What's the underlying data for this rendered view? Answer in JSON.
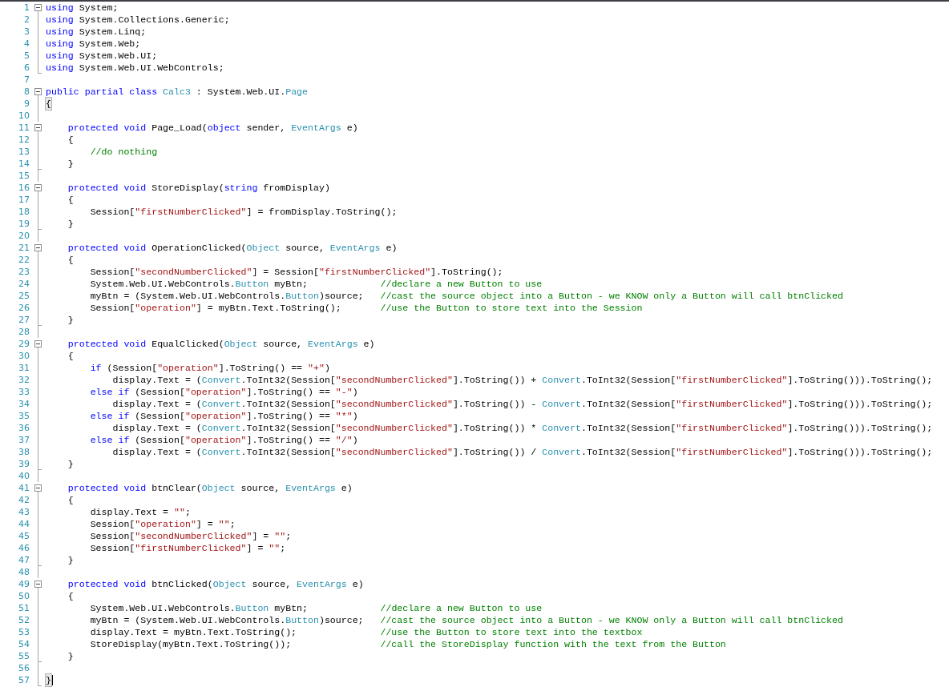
{
  "editor": {
    "lines": [
      {
        "number": "1",
        "kind": "fold_start",
        "tokens": [
          {
            "kind": "keyword",
            "text": "using"
          },
          {
            "kind": "plain",
            "text": " System;"
          }
        ]
      },
      {
        "number": "2",
        "kind": "fold_body",
        "tokens": [
          {
            "kind": "keyword",
            "text": "using"
          },
          {
            "kind": "plain",
            "text": " System.Collections.Generic;"
          }
        ]
      },
      {
        "number": "3",
        "kind": "fold_body",
        "tokens": [
          {
            "kind": "keyword",
            "text": "using"
          },
          {
            "kind": "plain",
            "text": " System.Linq;"
          }
        ]
      },
      {
        "number": "4",
        "kind": "fold_body",
        "tokens": [
          {
            "kind": "keyword",
            "text": "using"
          },
          {
            "kind": "plain",
            "text": " System.Web;"
          }
        ]
      },
      {
        "number": "5",
        "kind": "fold_body",
        "tokens": [
          {
            "kind": "keyword",
            "text": "using"
          },
          {
            "kind": "plain",
            "text": " System.Web.UI;"
          }
        ]
      },
      {
        "number": "6",
        "kind": "fold_end",
        "tokens": [
          {
            "kind": "keyword",
            "text": "using"
          },
          {
            "kind": "plain",
            "text": " System.Web.UI.WebControls;"
          }
        ]
      },
      {
        "number": "7",
        "kind": "plain"
      },
      {
        "number": "8",
        "kind": "fold_start",
        "tokens": [
          {
            "kind": "keyword",
            "text": "public partial class "
          },
          {
            "kind": "type",
            "text": "Calc3"
          },
          {
            "kind": "plain",
            "text": " : System.Web.UI."
          },
          {
            "kind": "type",
            "text": "Page"
          }
        ]
      },
      {
        "number": "9",
        "kind": "fold_body",
        "tokens": [
          {
            "kind": "brace",
            "text": "{"
          }
        ]
      },
      {
        "number": "10",
        "kind": "fold_body"
      },
      {
        "number": "11",
        "kind": "fold_start",
        "tokens": [
          {
            "kind": "keyword",
            "text": "    protected void"
          },
          {
            "kind": "plain",
            "text": " Page_Load("
          },
          {
            "kind": "keyword",
            "text": "object"
          },
          {
            "kind": "plain",
            "text": " sender, "
          },
          {
            "kind": "type",
            "text": "EventArgs"
          },
          {
            "kind": "plain",
            "text": " e)"
          }
        ]
      },
      {
        "number": "12",
        "kind": "fold_body",
        "tokens": [
          {
            "kind": "plain",
            "text": "    {"
          }
        ]
      },
      {
        "number": "13",
        "kind": "fold_body",
        "tokens": [
          {
            "kind": "comment",
            "text": "        //do nothing"
          }
        ]
      },
      {
        "number": "14",
        "kind": "fold_end",
        "tokens": [
          {
            "kind": "plain",
            "text": "    }"
          }
        ]
      },
      {
        "number": "15",
        "kind": "fold_body"
      },
      {
        "number": "16",
        "kind": "fold_start",
        "tokens": [
          {
            "kind": "keyword",
            "text": "    protected void"
          },
          {
            "kind": "plain",
            "text": " StoreDisplay("
          },
          {
            "kind": "keyword",
            "text": "string"
          },
          {
            "kind": "plain",
            "text": " fromDisplay)"
          }
        ]
      },
      {
        "number": "17",
        "kind": "fold_body",
        "tokens": [
          {
            "kind": "plain",
            "text": "    {"
          }
        ]
      },
      {
        "number": "18",
        "kind": "fold_body",
        "tokens": [
          {
            "kind": "plain",
            "text": "        Session["
          },
          {
            "kind": "string",
            "text": "\"firstNumberClicked\""
          },
          {
            "kind": "plain",
            "text": "] = fromDisplay.ToString();"
          }
        ]
      },
      {
        "number": "19",
        "kind": "fold_end",
        "tokens": [
          {
            "kind": "plain",
            "text": "    }"
          }
        ]
      },
      {
        "number": "20",
        "kind": "fold_body"
      },
      {
        "number": "21",
        "kind": "fold_start",
        "tokens": [
          {
            "kind": "keyword",
            "text": "    protected void"
          },
          {
            "kind": "plain",
            "text": " OperationClicked("
          },
          {
            "kind": "type",
            "text": "Object"
          },
          {
            "kind": "plain",
            "text": " source, "
          },
          {
            "kind": "type",
            "text": "EventArgs"
          },
          {
            "kind": "plain",
            "text": " e)"
          }
        ]
      },
      {
        "number": "22",
        "kind": "fold_body",
        "tokens": [
          {
            "kind": "plain",
            "text": "    {"
          }
        ]
      },
      {
        "number": "23",
        "kind": "fold_body",
        "tokens": [
          {
            "kind": "plain",
            "text": "        Session["
          },
          {
            "kind": "string",
            "text": "\"secondNumberClicked\""
          },
          {
            "kind": "plain",
            "text": "] = Session["
          },
          {
            "kind": "string",
            "text": "\"firstNumberClicked\""
          },
          {
            "kind": "plain",
            "text": "].ToString();"
          }
        ]
      },
      {
        "number": "24",
        "kind": "fold_body",
        "tokens": [
          {
            "kind": "plain",
            "text": "        System.Web.UI.WebControls."
          },
          {
            "kind": "type",
            "text": "Button"
          },
          {
            "kind": "plain",
            "text": " myBtn;             "
          },
          {
            "kind": "comment",
            "text": "//declare a new Button to use"
          }
        ]
      },
      {
        "number": "25",
        "kind": "fold_body",
        "tokens": [
          {
            "kind": "plain",
            "text": "        myBtn = (System.Web.UI.WebControls."
          },
          {
            "kind": "type",
            "text": "Button"
          },
          {
            "kind": "plain",
            "text": ")source;   "
          },
          {
            "kind": "comment",
            "text": "//cast the source object into a Button - we KNOW only a Button will call btnClicked"
          }
        ]
      },
      {
        "number": "26",
        "kind": "fold_body",
        "tokens": [
          {
            "kind": "plain",
            "text": "        Session["
          },
          {
            "kind": "string",
            "text": "\"operation\""
          },
          {
            "kind": "plain",
            "text": "] = myBtn.Text.ToString();       "
          },
          {
            "kind": "comment",
            "text": "//use the Button to store text into the Session"
          }
        ]
      },
      {
        "number": "27",
        "kind": "fold_end",
        "tokens": [
          {
            "kind": "plain",
            "text": "    }"
          }
        ]
      },
      {
        "number": "28",
        "kind": "fold_body"
      },
      {
        "number": "29",
        "kind": "fold_start",
        "tokens": [
          {
            "kind": "keyword",
            "text": "    protected void"
          },
          {
            "kind": "plain",
            "text": " EqualClicked("
          },
          {
            "kind": "type",
            "text": "Object"
          },
          {
            "kind": "plain",
            "text": " source, "
          },
          {
            "kind": "type",
            "text": "EventArgs"
          },
          {
            "kind": "plain",
            "text": " e)"
          }
        ]
      },
      {
        "number": "30",
        "kind": "fold_body",
        "tokens": [
          {
            "kind": "plain",
            "text": "    {"
          }
        ]
      },
      {
        "number": "31",
        "kind": "fold_body",
        "tokens": [
          {
            "kind": "keyword",
            "text": "        if"
          },
          {
            "kind": "plain",
            "text": " (Session["
          },
          {
            "kind": "string",
            "text": "\"operation\""
          },
          {
            "kind": "plain",
            "text": "].ToString() == "
          },
          {
            "kind": "string",
            "text": "\"+\""
          },
          {
            "kind": "plain",
            "text": ")"
          }
        ]
      },
      {
        "number": "32",
        "kind": "fold_body",
        "tokens": [
          {
            "kind": "plain",
            "text": "            display.Text = ("
          },
          {
            "kind": "type",
            "text": "Convert"
          },
          {
            "kind": "plain",
            "text": ".ToInt32(Session["
          },
          {
            "kind": "string",
            "text": "\"secondNumberClicked\""
          },
          {
            "kind": "plain",
            "text": "].ToString()) + "
          },
          {
            "kind": "type",
            "text": "Convert"
          },
          {
            "kind": "plain",
            "text": ".ToInt32(Session["
          },
          {
            "kind": "string",
            "text": "\"firstNumberClicked\""
          },
          {
            "kind": "plain",
            "text": "].ToString())).ToString();"
          }
        ]
      },
      {
        "number": "33",
        "kind": "fold_body",
        "tokens": [
          {
            "kind": "keyword",
            "text": "        else if"
          },
          {
            "kind": "plain",
            "text": " (Session["
          },
          {
            "kind": "string",
            "text": "\"operation\""
          },
          {
            "kind": "plain",
            "text": "].ToString() == "
          },
          {
            "kind": "string",
            "text": "\"-\""
          },
          {
            "kind": "plain",
            "text": ")"
          }
        ]
      },
      {
        "number": "34",
        "kind": "fold_body",
        "tokens": [
          {
            "kind": "plain",
            "text": "            display.Text = ("
          },
          {
            "kind": "type",
            "text": "Convert"
          },
          {
            "kind": "plain",
            "text": ".ToInt32(Session["
          },
          {
            "kind": "string",
            "text": "\"secondNumberClicked\""
          },
          {
            "kind": "plain",
            "text": "].ToString()) - "
          },
          {
            "kind": "type",
            "text": "Convert"
          },
          {
            "kind": "plain",
            "text": ".ToInt32(Session["
          },
          {
            "kind": "string",
            "text": "\"firstNumberClicked\""
          },
          {
            "kind": "plain",
            "text": "].ToString())).ToString();"
          }
        ]
      },
      {
        "number": "35",
        "kind": "fold_body",
        "tokens": [
          {
            "kind": "keyword",
            "text": "        else if"
          },
          {
            "kind": "plain",
            "text": " (Session["
          },
          {
            "kind": "string",
            "text": "\"operation\""
          },
          {
            "kind": "plain",
            "text": "].ToString() == "
          },
          {
            "kind": "string",
            "text": "\"*\""
          },
          {
            "kind": "plain",
            "text": ")"
          }
        ]
      },
      {
        "number": "36",
        "kind": "fold_body",
        "tokens": [
          {
            "kind": "plain",
            "text": "            display.Text = ("
          },
          {
            "kind": "type",
            "text": "Convert"
          },
          {
            "kind": "plain",
            "text": ".ToInt32(Session["
          },
          {
            "kind": "string",
            "text": "\"secondNumberClicked\""
          },
          {
            "kind": "plain",
            "text": "].ToString()) * "
          },
          {
            "kind": "type",
            "text": "Convert"
          },
          {
            "kind": "plain",
            "text": ".ToInt32(Session["
          },
          {
            "kind": "string",
            "text": "\"firstNumberClicked\""
          },
          {
            "kind": "plain",
            "text": "].ToString())).ToString();"
          }
        ]
      },
      {
        "number": "37",
        "kind": "fold_body",
        "tokens": [
          {
            "kind": "keyword",
            "text": "        else if"
          },
          {
            "kind": "plain",
            "text": " (Session["
          },
          {
            "kind": "string",
            "text": "\"operation\""
          },
          {
            "kind": "plain",
            "text": "].ToString() == "
          },
          {
            "kind": "string",
            "text": "\"/\""
          },
          {
            "kind": "plain",
            "text": ")"
          }
        ]
      },
      {
        "number": "38",
        "kind": "fold_body",
        "tokens": [
          {
            "kind": "plain",
            "text": "            display.Text = ("
          },
          {
            "kind": "type",
            "text": "Convert"
          },
          {
            "kind": "plain",
            "text": ".ToInt32(Session["
          },
          {
            "kind": "string",
            "text": "\"secondNumberClicked\""
          },
          {
            "kind": "plain",
            "text": "].ToString()) / "
          },
          {
            "kind": "type",
            "text": "Convert"
          },
          {
            "kind": "plain",
            "text": ".ToInt32(Session["
          },
          {
            "kind": "string",
            "text": "\"firstNumberClicked\""
          },
          {
            "kind": "plain",
            "text": "].ToString())).ToString();"
          }
        ]
      },
      {
        "number": "39",
        "kind": "fold_end",
        "tokens": [
          {
            "kind": "plain",
            "text": "    }"
          }
        ]
      },
      {
        "number": "40",
        "kind": "fold_body"
      },
      {
        "number": "41",
        "kind": "fold_start",
        "tokens": [
          {
            "kind": "keyword",
            "text": "    protected void"
          },
          {
            "kind": "plain",
            "text": " btnClear("
          },
          {
            "kind": "type",
            "text": "Object"
          },
          {
            "kind": "plain",
            "text": " source, "
          },
          {
            "kind": "type",
            "text": "EventArgs"
          },
          {
            "kind": "plain",
            "text": " e)"
          }
        ]
      },
      {
        "number": "42",
        "kind": "fold_body",
        "tokens": [
          {
            "kind": "plain",
            "text": "    {"
          }
        ]
      },
      {
        "number": "43",
        "kind": "fold_body",
        "tokens": [
          {
            "kind": "plain",
            "text": "        display.Text = "
          },
          {
            "kind": "string",
            "text": "\"\""
          },
          {
            "kind": "plain",
            "text": ";"
          }
        ]
      },
      {
        "number": "44",
        "kind": "fold_body",
        "tokens": [
          {
            "kind": "plain",
            "text": "        Session["
          },
          {
            "kind": "string",
            "text": "\"operation\""
          },
          {
            "kind": "plain",
            "text": "] = "
          },
          {
            "kind": "string",
            "text": "\"\""
          },
          {
            "kind": "plain",
            "text": ";"
          }
        ]
      },
      {
        "number": "45",
        "kind": "fold_body",
        "tokens": [
          {
            "kind": "plain",
            "text": "        Session["
          },
          {
            "kind": "string",
            "text": "\"secondNumberClicked\""
          },
          {
            "kind": "plain",
            "text": "] = "
          },
          {
            "kind": "string",
            "text": "\"\""
          },
          {
            "kind": "plain",
            "text": ";"
          }
        ]
      },
      {
        "number": "46",
        "kind": "fold_body",
        "tokens": [
          {
            "kind": "plain",
            "text": "        Session["
          },
          {
            "kind": "string",
            "text": "\"firstNumberClicked\""
          },
          {
            "kind": "plain",
            "text": "] = "
          },
          {
            "kind": "string",
            "text": "\"\""
          },
          {
            "kind": "plain",
            "text": ";"
          }
        ]
      },
      {
        "number": "47",
        "kind": "fold_end",
        "tokens": [
          {
            "kind": "plain",
            "text": "    }"
          }
        ]
      },
      {
        "number": "48",
        "kind": "fold_body"
      },
      {
        "number": "49",
        "kind": "fold_start",
        "tokens": [
          {
            "kind": "keyword",
            "text": "    protected void"
          },
          {
            "kind": "plain",
            "text": " btnClicked("
          },
          {
            "kind": "type",
            "text": "Object"
          },
          {
            "kind": "plain",
            "text": " source, "
          },
          {
            "kind": "type",
            "text": "EventArgs"
          },
          {
            "kind": "plain",
            "text": " e)"
          }
        ]
      },
      {
        "number": "50",
        "kind": "fold_body",
        "tokens": [
          {
            "kind": "plain",
            "text": "    {"
          }
        ]
      },
      {
        "number": "51",
        "kind": "fold_body",
        "tokens": [
          {
            "kind": "plain",
            "text": "        System.Web.UI.WebControls."
          },
          {
            "kind": "type",
            "text": "Button"
          },
          {
            "kind": "plain",
            "text": " myBtn;             "
          },
          {
            "kind": "comment",
            "text": "//declare a new Button to use"
          }
        ]
      },
      {
        "number": "52",
        "kind": "fold_body",
        "tokens": [
          {
            "kind": "plain",
            "text": "        myBtn = (System.Web.UI.WebControls."
          },
          {
            "kind": "type",
            "text": "Button"
          },
          {
            "kind": "plain",
            "text": ")source;   "
          },
          {
            "kind": "comment",
            "text": "//cast the source object into a Button - we KNOW only a Button will call btnClicked"
          }
        ]
      },
      {
        "number": "53",
        "kind": "fold_body",
        "tokens": [
          {
            "kind": "plain",
            "text": "        display.Text = myBtn.Text.ToString();               "
          },
          {
            "kind": "comment",
            "text": "//use the Button to store text into the textbox"
          }
        ]
      },
      {
        "number": "54",
        "kind": "fold_body",
        "tokens": [
          {
            "kind": "plain",
            "text": "        StoreDisplay(myBtn.Text.ToString());                "
          },
          {
            "kind": "comment",
            "text": "//call the StoreDisplay function with the text from the Button"
          }
        ]
      },
      {
        "number": "55",
        "kind": "fold_end",
        "tokens": [
          {
            "kind": "plain",
            "text": "    }"
          }
        ]
      },
      {
        "number": "56",
        "kind": "fold_body"
      },
      {
        "number": "57",
        "kind": "fold_end",
        "cursor": true,
        "tokens": [
          {
            "kind": "brace",
            "text": "}"
          }
        ]
      }
    ]
  }
}
